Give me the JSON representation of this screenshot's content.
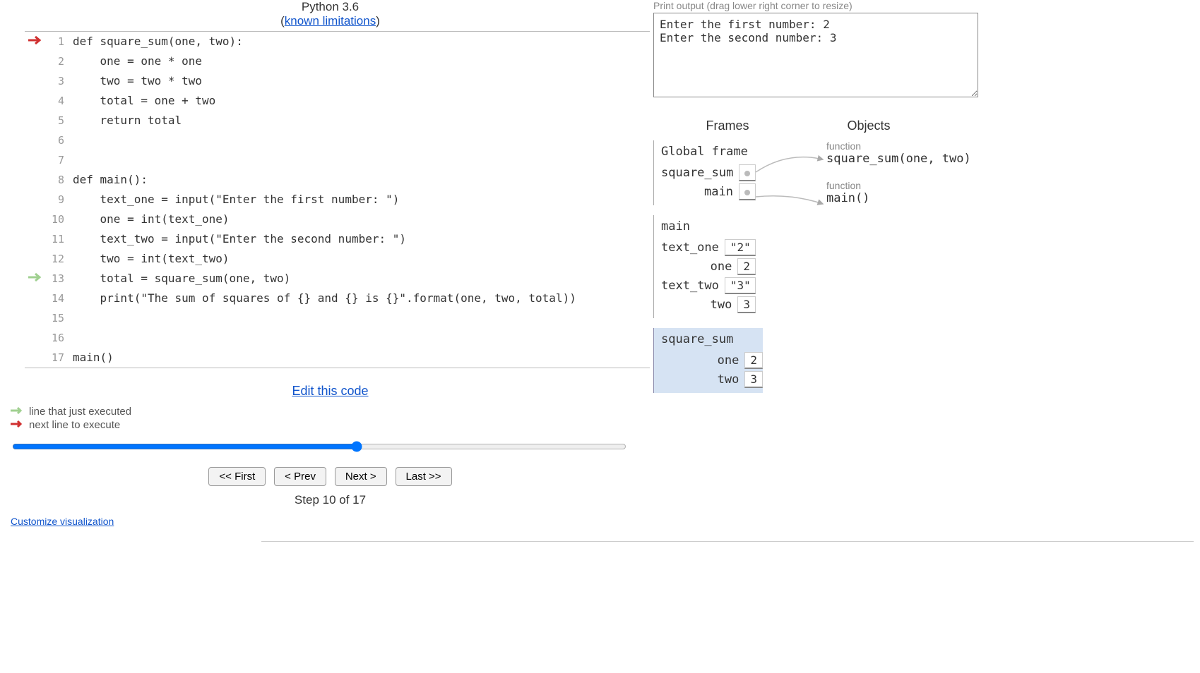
{
  "header": {
    "title": "Python 3.6",
    "link_text": "known limitations"
  },
  "code": {
    "lines": [
      {
        "n": 1,
        "text": "def square_sum(one, two):",
        "next_arrow": true
      },
      {
        "n": 2,
        "text": "    one = one * one"
      },
      {
        "n": 3,
        "text": "    two = two * two"
      },
      {
        "n": 4,
        "text": "    total = one + two"
      },
      {
        "n": 5,
        "text": "    return total"
      },
      {
        "n": 6,
        "text": ""
      },
      {
        "n": 7,
        "text": ""
      },
      {
        "n": 8,
        "text": "def main():"
      },
      {
        "n": 9,
        "text": "    text_one = input(\"Enter the first number: \")"
      },
      {
        "n": 10,
        "text": "    one = int(text_one)"
      },
      {
        "n": 11,
        "text": "    text_two = input(\"Enter the second number: \")"
      },
      {
        "n": 12,
        "text": "    two = int(text_two)"
      },
      {
        "n": 13,
        "text": "    total = square_sum(one, two)",
        "prev_arrow": true
      },
      {
        "n": 14,
        "text": "    print(\"The sum of squares of {} and {} is {}\".format(one, two, total))"
      },
      {
        "n": 15,
        "text": ""
      },
      {
        "n": 16,
        "text": ""
      },
      {
        "n": 17,
        "text": "main()"
      }
    ]
  },
  "edit_link": "Edit this code",
  "legend": {
    "prev": "line that just executed",
    "next": "next line to execute"
  },
  "slider": {
    "min": 1,
    "max": 17,
    "value": 10
  },
  "buttons": {
    "first": "<< First",
    "prev": "< Prev",
    "next": "Next >",
    "last": "Last >>"
  },
  "step_label": "Step 10 of 17",
  "customize": "Customize visualization",
  "output": {
    "label": "Print output (drag lower right corner to resize)",
    "text": "Enter the first number: 2\nEnter the second number: 3"
  },
  "fo_header": {
    "frames": "Frames",
    "objects": "Objects"
  },
  "frames": {
    "global": {
      "title": "Global frame",
      "vars": [
        {
          "name": "square_sum",
          "pointer": true
        },
        {
          "name": "main",
          "pointer": true
        }
      ]
    },
    "main": {
      "title": "main",
      "vars": [
        {
          "name": "text_one",
          "val": "\"2\""
        },
        {
          "name": "one",
          "val": "2"
        },
        {
          "name": "text_two",
          "val": "\"3\""
        },
        {
          "name": "two",
          "val": "3"
        }
      ]
    },
    "square_sum": {
      "title": "square_sum",
      "vars": [
        {
          "name": "one",
          "val": "2"
        },
        {
          "name": "two",
          "val": "3"
        }
      ]
    }
  },
  "objects": [
    {
      "label": "function",
      "value": "square_sum(one, two)"
    },
    {
      "label": "function",
      "value": "main()"
    }
  ]
}
